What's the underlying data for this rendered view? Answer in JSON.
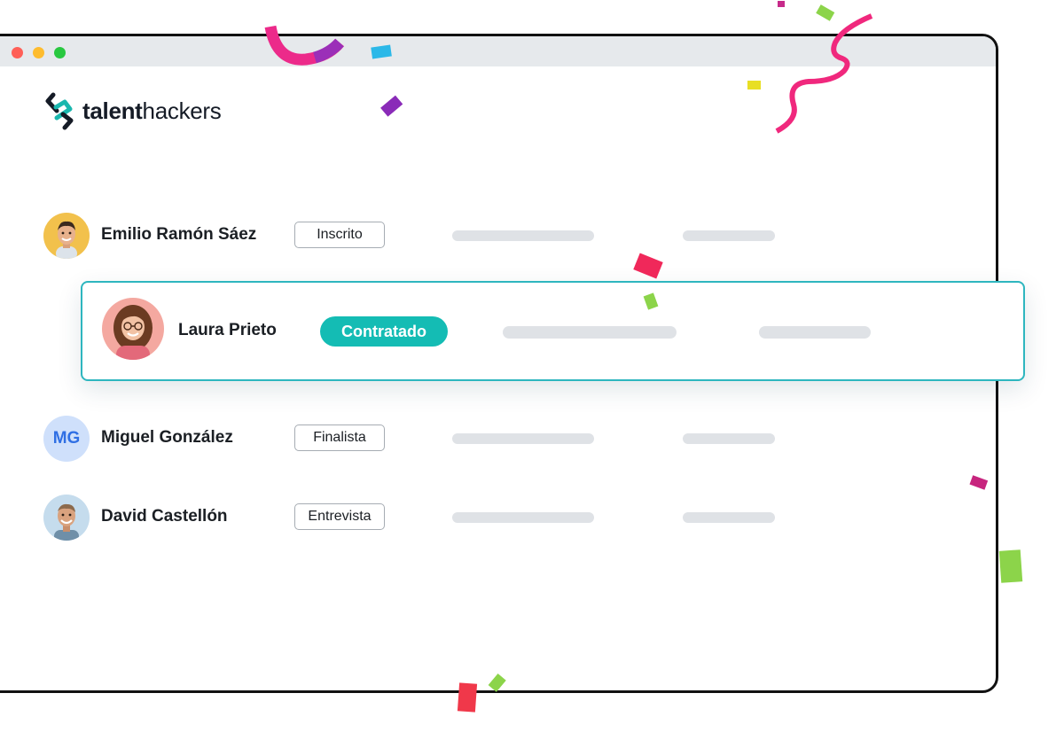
{
  "brand": {
    "name_bold": "talent",
    "name_regular": "hackers",
    "logo_icon": "talenthackers-logo-icon",
    "color": "#151b26"
  },
  "candidates": [
    {
      "name": "Emilio Ramón Sáez",
      "status": "Inscrito",
      "avatar": "photo"
    },
    {
      "name": "Laura Prieto",
      "status": "Contratado",
      "avatar": "photo",
      "highlighted": true
    },
    {
      "name": "Miguel González",
      "status": "Finalista",
      "avatar_initials": "MG"
    },
    {
      "name": "David Castellón",
      "status": "Entrevista",
      "avatar": "photo"
    }
  ],
  "colors": {
    "accent": "#14bcb4",
    "highlight_border": "#2eb6bf",
    "placeholder_bar": "#dfe2e6",
    "initials_bg": "#cfe0fb",
    "initials_text": "#2f6fe4"
  }
}
